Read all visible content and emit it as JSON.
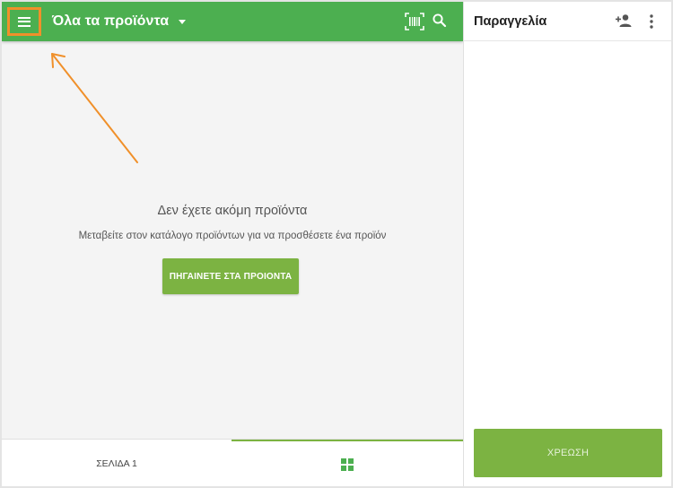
{
  "header": {
    "title": "Όλα τα προϊόντα",
    "menu_icon": "menu-icon",
    "barcode_icon": "barcode-scan-icon",
    "search_icon": "search-icon"
  },
  "empty_state": {
    "title": "Δεν έχετε ακόμη προϊόντα",
    "subtitle": "Μεταβείτε στον κατάλογο προϊόντων για να προσθέσετε ένα προϊόν",
    "button_label": "ΠΗΓΑΙΝΕΤΕ ΣΤΑ ΠΡΟΙΟΝΤΑ"
  },
  "bottom_tabs": {
    "page_label": "ΣΕΛΙΔΑ 1",
    "grid_icon": "grid-icon"
  },
  "order_panel": {
    "title": "Παραγγελία",
    "add_customer_icon": "add-person-icon",
    "more_icon": "more-vert-icon",
    "charge_label": "ΧΡΕΩΣΗ"
  },
  "colors": {
    "primary_green": "#4caf50",
    "button_green": "#7cb342",
    "highlight_orange": "#f0902a"
  }
}
